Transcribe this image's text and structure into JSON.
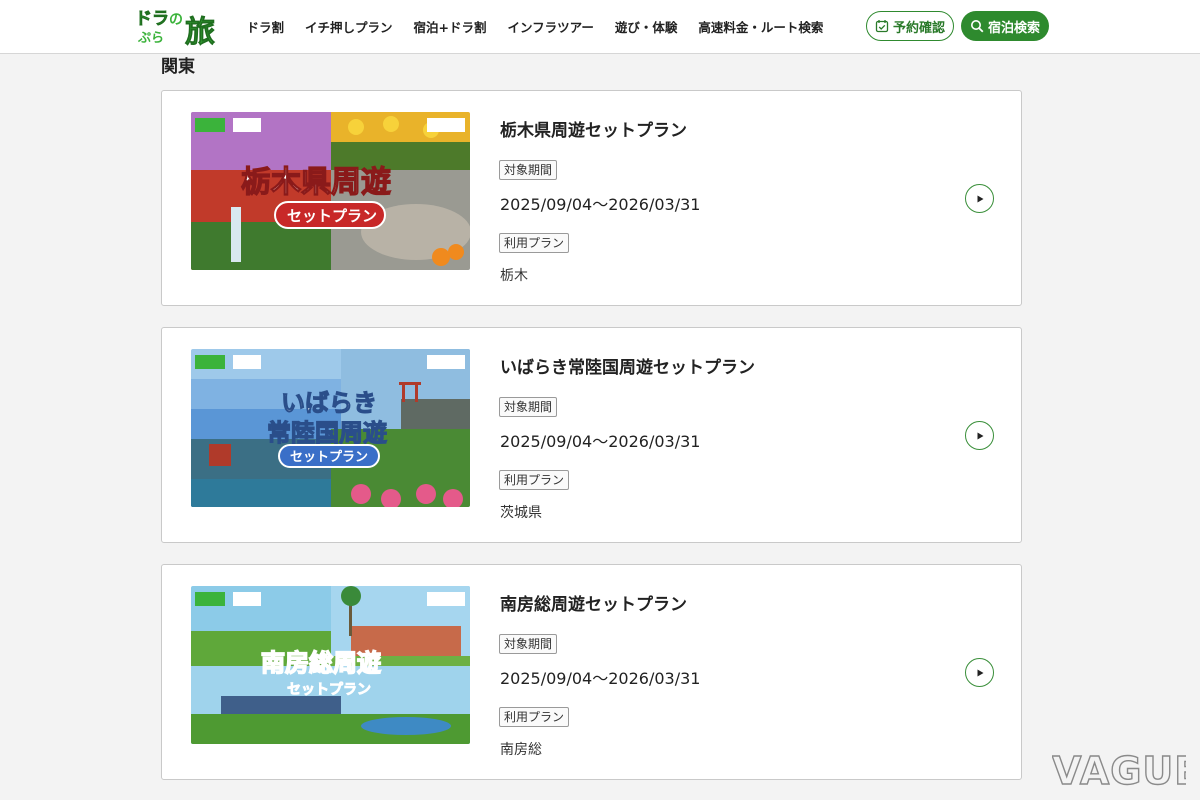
{
  "header": {
    "logo_alt": "ドラぷらの旅",
    "nav": [
      "ドラ割",
      "イチ押しプラン",
      "宿泊+ドラ割",
      "インフラツアー",
      "遊び・体験",
      "高速料金・ルート検索"
    ],
    "reserve_label": "予約確認",
    "search_label": "宿泊検索"
  },
  "section_title": "関東",
  "labels": {
    "period": "対象期間",
    "plan": "利用プラン"
  },
  "plans": [
    {
      "title": "栃木県周遊セットプラン",
      "period": "2025/09/04～2026/03/31",
      "area": "栃木",
      "banner_line1": "栃木県周遊",
      "banner_line2": "セットプラン"
    },
    {
      "title": "いばらき常陸国周遊セットプラン",
      "period": "2025/09/04～2026/03/31",
      "area": "茨城県",
      "banner_line1": "いばらき",
      "banner_line2": "常陸国周遊",
      "banner_line3": "セットプラン"
    },
    {
      "title": "南房総周遊セットプラン",
      "period": "2025/09/04～2026/03/31",
      "area": "南房総",
      "banner_line1": "南房総周遊",
      "banner_line2": "セットプラン"
    }
  ],
  "watermark": "VAGUE",
  "colors": {
    "brand_green": "#2e8a2e",
    "logo_green": "#3bb33b",
    "background": "#f3f3f3"
  }
}
